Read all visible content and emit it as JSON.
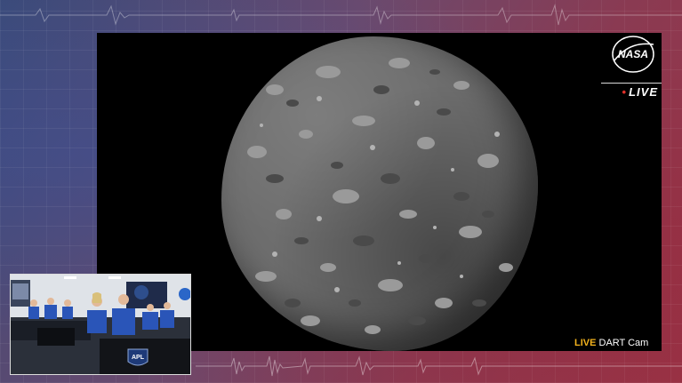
{
  "broadcast": {
    "live_badge": "LIVE",
    "nasa_logo_text": "NASA",
    "camera_live": "LIVE",
    "camera_name": "DART Cam"
  },
  "pip": {
    "apl_logo_text": "APL"
  },
  "colors": {
    "live_badge_dot": "#e0302a",
    "camera_live_text": "#f2b21d",
    "feed_background": "#000000",
    "team_shirts": "#2a55b8"
  }
}
